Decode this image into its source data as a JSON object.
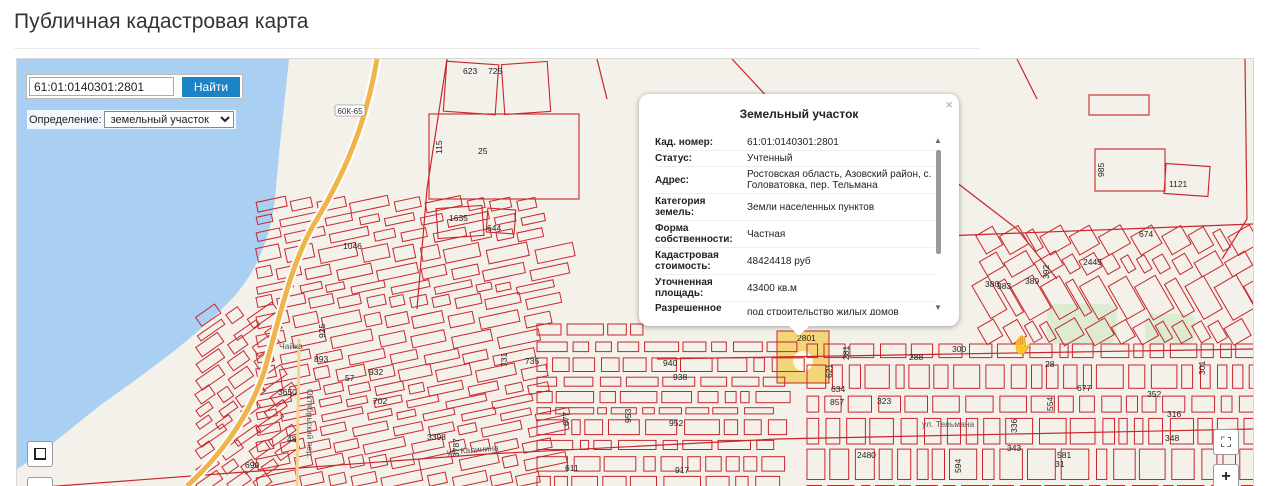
{
  "page": {
    "title": "Публичная кадастровая карта"
  },
  "search": {
    "value": "61:01:0140301:2801",
    "button_label": "Найти"
  },
  "definition": {
    "label": "Определение:",
    "selected": "земельный участок"
  },
  "popup": {
    "title": "Земельный участок",
    "close_glyph": "×",
    "rows": [
      {
        "key": "Кад. номер:",
        "value": "61:01:0140301:2801"
      },
      {
        "key": "Статус:",
        "value": "Учтенный"
      },
      {
        "key": "Адрес:",
        "value": "Ростовская область, Азовский район, с. Головатовка, пер. Тельмана"
      },
      {
        "key": "Категория земель:",
        "value": "Земли населенных пунктов"
      },
      {
        "key": "Форма собственности:",
        "value": "Частная"
      },
      {
        "key": "Кадастровая стоимость:",
        "value": "48424418 руб"
      },
      {
        "key": "Уточненная площадь:",
        "value": "43400 кв.м"
      },
      {
        "key": "Разрешенное",
        "value": "под строительство жилых домов"
      }
    ]
  },
  "map": {
    "water_color": "#a9d0f2",
    "road_color": "#f0b54a",
    "parcel_color": "#c8262c",
    "road_label": "60К-65",
    "place_labels": [
      "Октябрьский пер.",
      "ул. Калинина",
      "ул. Тельмана",
      "Чайка"
    ],
    "parcel_labels": [
      "623",
      "725",
      "115",
      "25",
      "1635",
      "644",
      "985",
      "1121",
      "674",
      "2445",
      "392",
      "389",
      "380",
      "383",
      "925",
      "893",
      "932",
      "57",
      "731",
      "735",
      "940",
      "938",
      "953",
      "952",
      "917",
      "2801",
      "621",
      "634",
      "857",
      "323",
      "281",
      "288",
      "300",
      "677",
      "554",
      "352",
      "316",
      "348",
      "336",
      "343",
      "581",
      "2480",
      "594",
      "31",
      "3650",
      "3398",
      "3787",
      "702",
      "690",
      "48",
      "677",
      "611",
      "1046",
      "28",
      "301"
    ]
  },
  "controls": {
    "fullscreen_glyph": "⛶",
    "zoom_in": "+"
  }
}
